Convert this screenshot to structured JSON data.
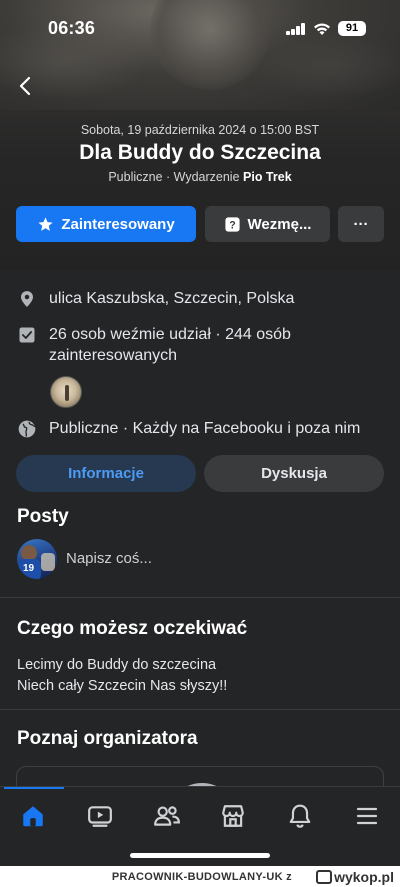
{
  "status": {
    "time": "06:36",
    "battery": "91"
  },
  "event": {
    "date": "Sobota, 19 października 2024 o 15:00 BST",
    "title": "Dla Buddy do Szczecina",
    "visibility_prefix": "Publiczne · Wydarzenie ",
    "organizer": "Pio Trek"
  },
  "actions": {
    "interested": "Zainteresowany",
    "going": "Wezmę...",
    "more": "···"
  },
  "details": {
    "location": "ulica Kaszubska, Szczecin, Polska",
    "attendance": "26 osob weźmie udział · 244 osób zainteresowanych",
    "privacy": "Publiczne · Każdy na Facebooku i poza nim"
  },
  "tabs": {
    "info": "Informacje",
    "discussion": "Dyskusja"
  },
  "posts": {
    "title": "Posty",
    "compose_placeholder": "Napisz coś..."
  },
  "expect": {
    "title": "Czego możesz oczekiwać",
    "lines": [
      "Lecimy do Buddy do szczecina",
      "Niech cały Szczecin Nas słyszy!!"
    ]
  },
  "organizer_section": {
    "title": "Poznaj organizatora"
  },
  "nav": [
    "home-icon",
    "video-icon",
    "friends-icon",
    "marketplace-icon",
    "bell-icon",
    "menu-icon"
  ],
  "watermark": {
    "text": "PRACOWNIK-BUDOWLANY-UK  z",
    "brand": "wykop.pl"
  },
  "colors": {
    "accent": "#1877f2",
    "background": "#242526",
    "tab_active_text": "#4d9bf5"
  }
}
